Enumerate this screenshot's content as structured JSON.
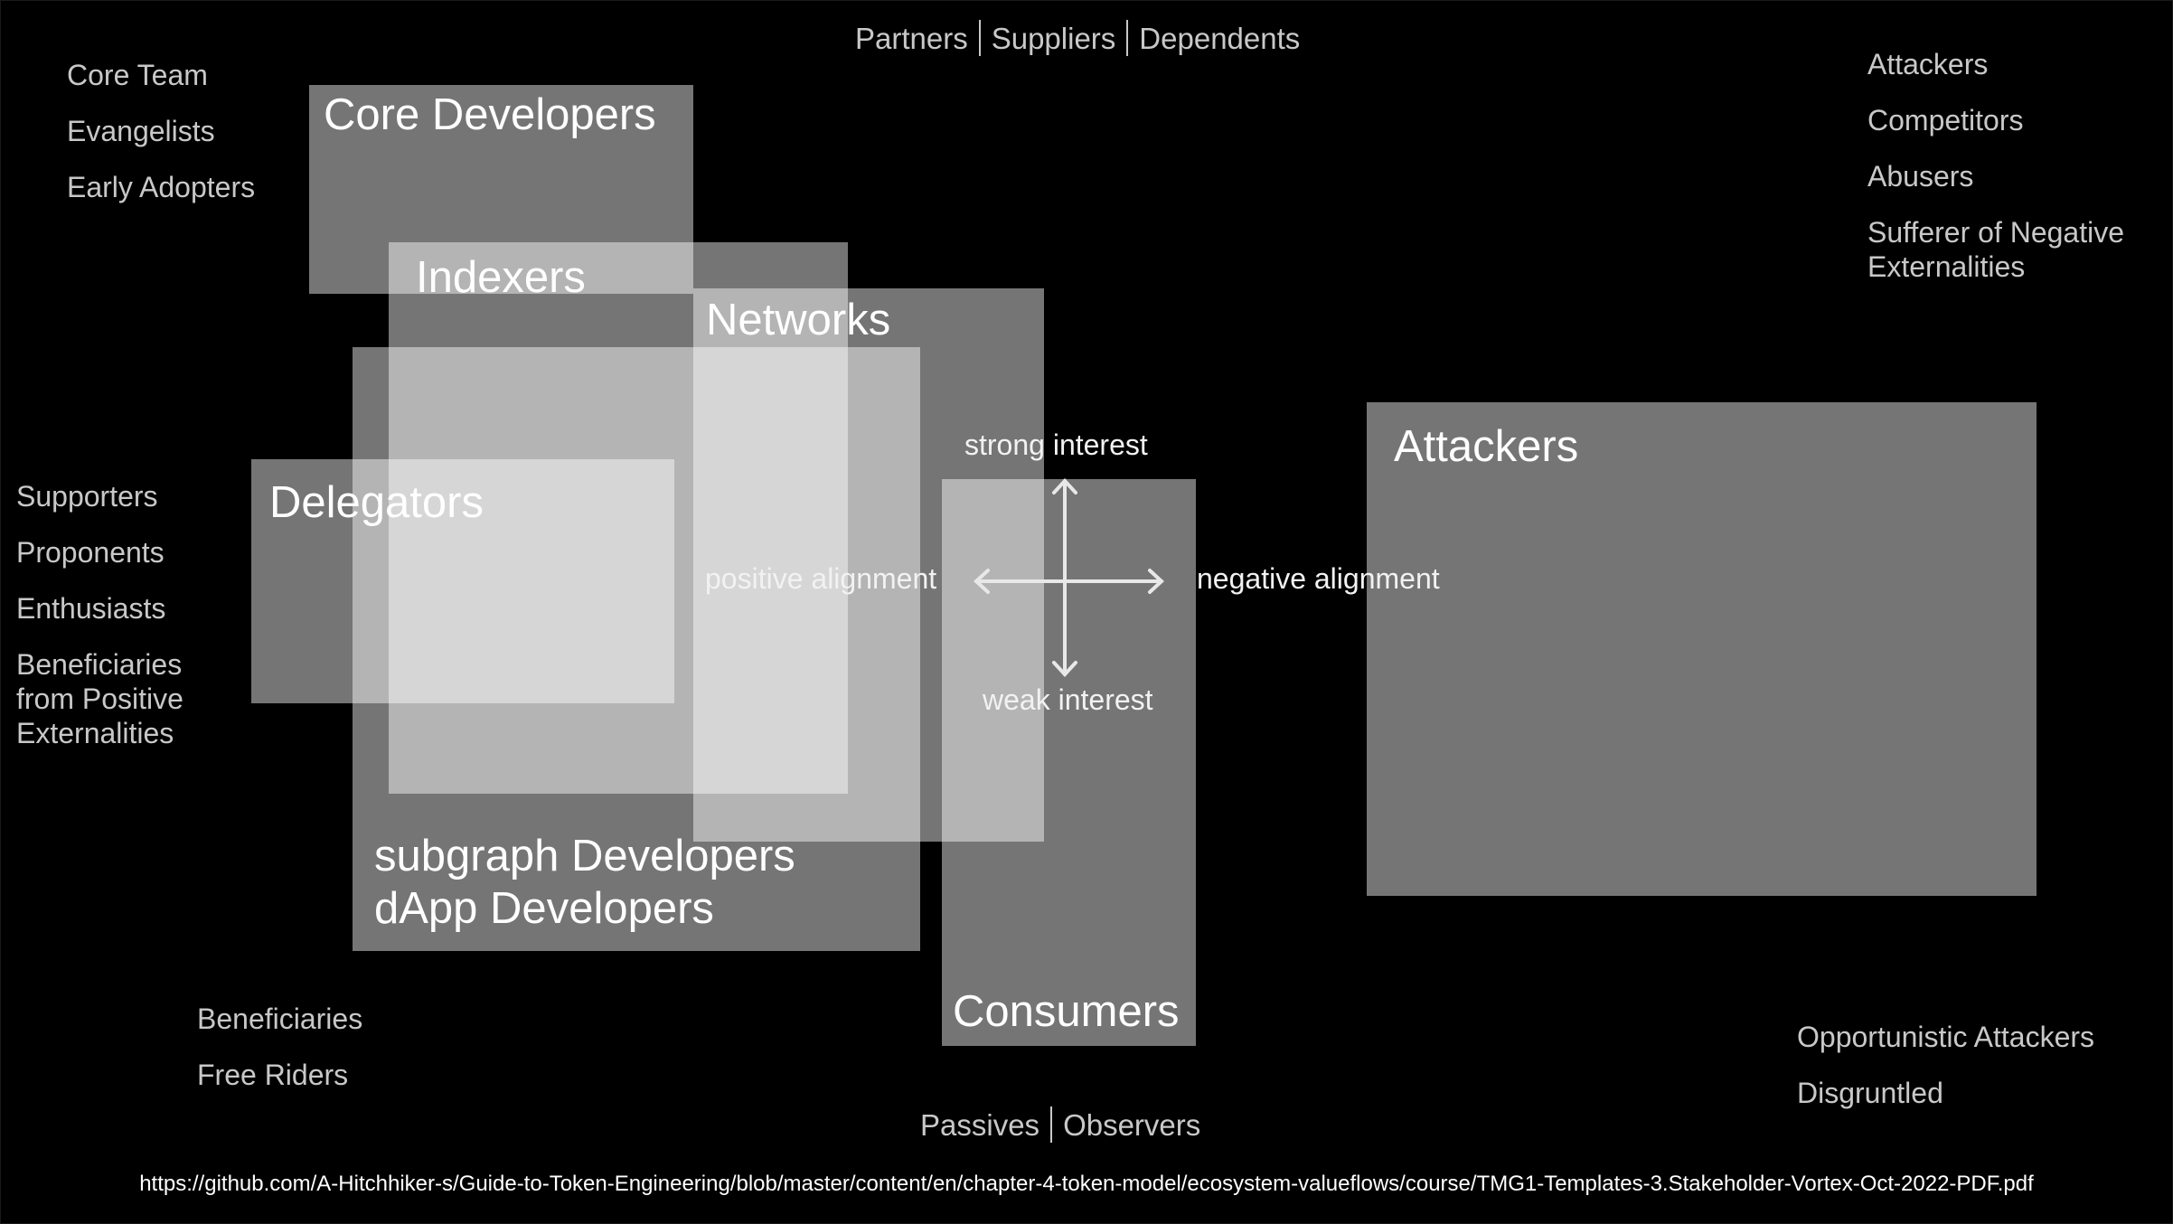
{
  "diagram": {
    "title_top": [
      "Partners",
      "Suppliers",
      "Dependents"
    ],
    "title_bottom": [
      "Passives",
      "Observers"
    ],
    "source_url": "https://github.com/A-Hitchhiker-s/Guide-to-Token-Engineering/blob/master/content/en/chapter-4-token-model/ecosystem-valueflows/course/TMG1-Templates-3.Stakeholder-Vortex-Oct-2022-PDF.pdf",
    "axes": {
      "top": "strong interest",
      "bottom": "weak interest",
      "left": "positive alignment",
      "right": "negative alignment"
    },
    "stakeholder_groups": {
      "core_developers": "Core Developers",
      "indexers": "Indexers",
      "networks": "Networks",
      "delegators": "Delegators",
      "subgraph_dapp_line1": "subgraph Developers",
      "subgraph_dapp_line2": "dApp Developers",
      "consumers": "Consumers",
      "attackers": "Attackers"
    },
    "corner_lists": {
      "top_left": [
        "Core Team",
        "Evangelists",
        "Early Adopters"
      ],
      "mid_left": [
        "Supporters",
        "Proponents",
        "Enthusiasts",
        "Beneficiaries from Positive Externalities"
      ],
      "bottom_left": [
        "Beneficiaries",
        "Free Riders"
      ],
      "top_right": [
        "Attackers",
        "Competitors",
        "Abusers",
        "Sufferer of Negative Externalities"
      ],
      "bottom_right": [
        "Opportunistic Attackers",
        "Disgruntled"
      ]
    }
  }
}
